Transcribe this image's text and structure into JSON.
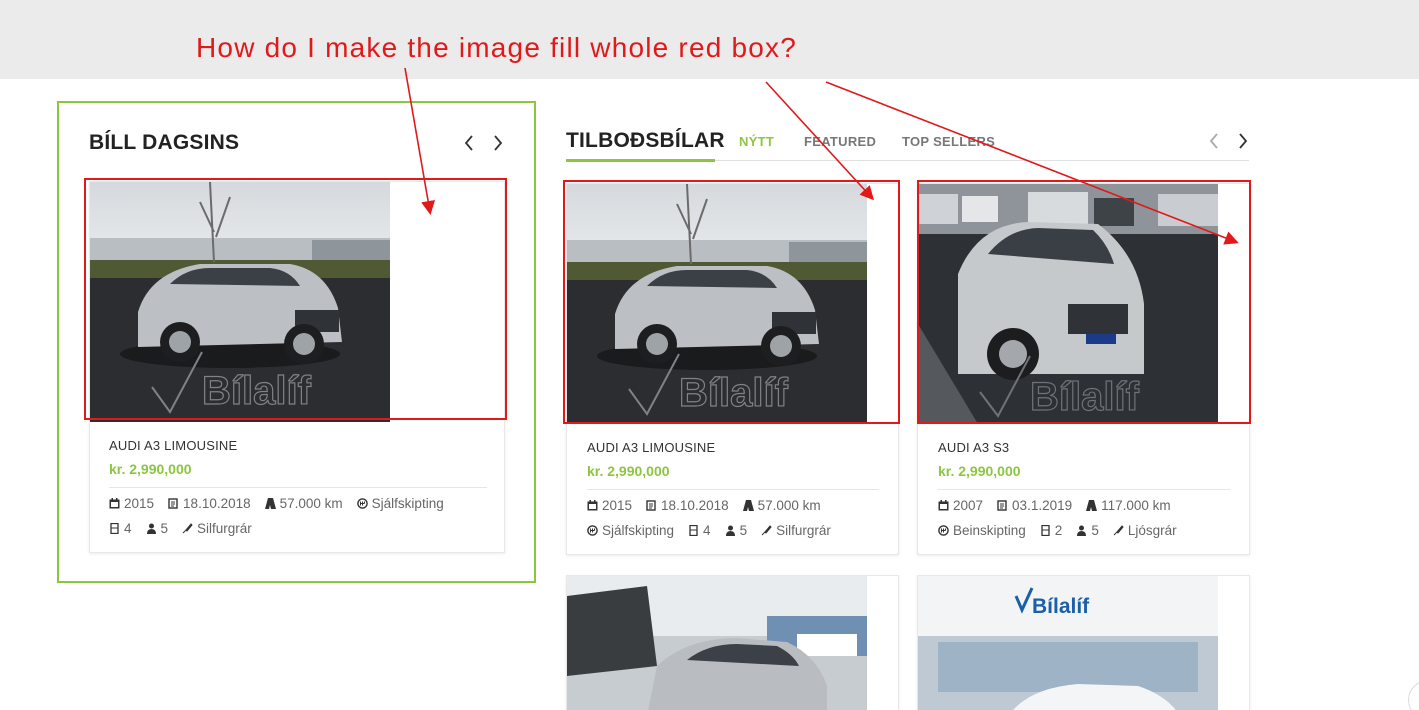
{
  "annotation": {
    "question": "How do I make the image fill whole red box?"
  },
  "left_panel": {
    "title": "BÍLL DAGSINS",
    "card": {
      "name": "AUDI A3 LIMOUSINE",
      "price": "kr. 2,990,000",
      "specs_row1": [
        "2015",
        "18.10.2018",
        "57.000 km",
        "Sjálfskipting"
      ],
      "specs_row2": [
        "4",
        "5",
        "Silfurgrár"
      ],
      "watermark": "Bílalíf"
    }
  },
  "offers": {
    "title": "TILBOÐSBÍLAR",
    "tabs": [
      "NÝTT",
      "FEATURED",
      "TOP SELLERS"
    ],
    "cards": [
      {
        "name": "AUDI A3 LIMOUSINE",
        "price": "kr. 2,990,000",
        "specs_row1": [
          "2015",
          "18.10.2018",
          "57.000 km"
        ],
        "specs_row2": [
          "Sjálfskipting",
          "4",
          "5",
          "Silfurgrár"
        ],
        "watermark": "Bílalíf"
      },
      {
        "name": "AUDI A3 S3",
        "price": "kr. 2,990,000",
        "specs_row1": [
          "2007",
          "03.1.2019",
          "117.000 km"
        ],
        "specs_row2": [
          "Beinskipting",
          "2",
          "5",
          "Ljósgrár"
        ],
        "watermark": "Bílalíf"
      }
    ],
    "lower_photo_sign": "Bílalíf"
  },
  "colors": {
    "accent": "#8cc63f",
    "annotation_red": "#e0191b"
  },
  "icons": {
    "spec_row1": [
      "calendar-icon",
      "registration-icon",
      "road-icon",
      "transmission-icon"
    ],
    "spec_row2": [
      "door-icon",
      "person-icon",
      "color-icon"
    ]
  }
}
